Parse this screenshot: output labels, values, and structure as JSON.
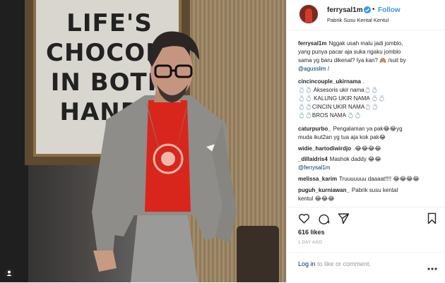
{
  "photo": {
    "frame_text": [
      "LIFE'S",
      "CHOCOLAT",
      "IN BOTH",
      "HANDS"
    ]
  },
  "header": {
    "username": "ferrysal1m",
    "separator": "•",
    "follow_label": "Follow",
    "location": "Pabrik Susu Kental Kentul"
  },
  "comments": [
    {
      "user": "ferrysal1m",
      "lines": [
        "Nggak usah malu jadi jomblo,",
        "yang punya pacar aja suka ngaku jomblo",
        "sama yg baru dikenal? Iya kan? 🙈 /suit by"
      ],
      "mention": "@agusslim /"
    },
    {
      "user": "cincincouple_ukirnama",
      "lines": [
        ".",
        "💍💍 Aksesoris ukir nama💍💍",
        "💍💍 KALUNG UKIR NAMA 💍💍",
        "💍💍CINCIN UKIR NAMA💍💍",
        "💍💍BROS NAMA 💍💍"
      ]
    },
    {
      "user": "caturpurbo_",
      "lines": [
        "Pengalaman ya pak😂😂yg",
        "muda ikut2an yg tua aja kok pak😂"
      ]
    },
    {
      "user": "widie_hartodiwirdjo",
      "lines": [
        ".😂😂😂😂"
      ]
    },
    {
      "user": "_dillaidris4",
      "lines": [
        "Mashok daddy 😂😂"
      ],
      "mention": "@ferrysal1m"
    },
    {
      "user": "melissa_karim",
      "lines": [
        "Truuuuuuu daaaat!!!! 😂😂😂😂"
      ]
    },
    {
      "user": "puguh_kurniawan_",
      "lines": [
        "Pabrik susu kental",
        "kentul 😂😂😂"
      ]
    }
  ],
  "actions": {
    "like_icon": "heart-icon",
    "comment_icon": "comment-icon",
    "share_icon": "share-icon",
    "save_icon": "bookmark-icon"
  },
  "likes": "616 likes",
  "time": "1 DAY AGO",
  "footer": {
    "login_link": "Log in",
    "login_rest": " to like or comment."
  },
  "colors": {
    "link_blue": "#3897f0",
    "mention_blue": "#003569",
    "muted": "#999999",
    "shirt_red": "#d9261c"
  }
}
